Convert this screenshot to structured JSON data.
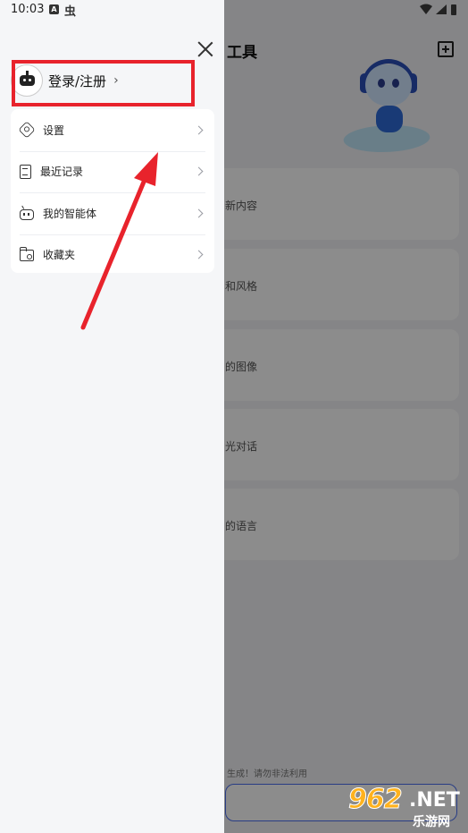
{
  "status_bar": {
    "time": "10:03",
    "notif_a": "A",
    "notif_bug": "虫"
  },
  "background": {
    "title": "工具",
    "cards": [
      "新内容",
      "和风格",
      "的图像",
      "光对话",
      "的语言"
    ],
    "notice": "生成！请勿非法利用"
  },
  "drawer": {
    "login_label": "登录/注册",
    "login_chevron": "›",
    "menu": [
      {
        "label": "设置",
        "icon": "gear-icon"
      },
      {
        "label": "最近记录",
        "icon": "document-icon"
      },
      {
        "label": "我的智能体",
        "icon": "robot-icon"
      },
      {
        "label": "收藏夹",
        "icon": "folder-icon"
      }
    ]
  },
  "watermark": {
    "number": "962",
    "domain": ".NET",
    "name": "乐游网"
  },
  "colors": {
    "highlight": "#e8232c",
    "accent": "#4a6ef0",
    "watermark": "#ffb21e"
  }
}
